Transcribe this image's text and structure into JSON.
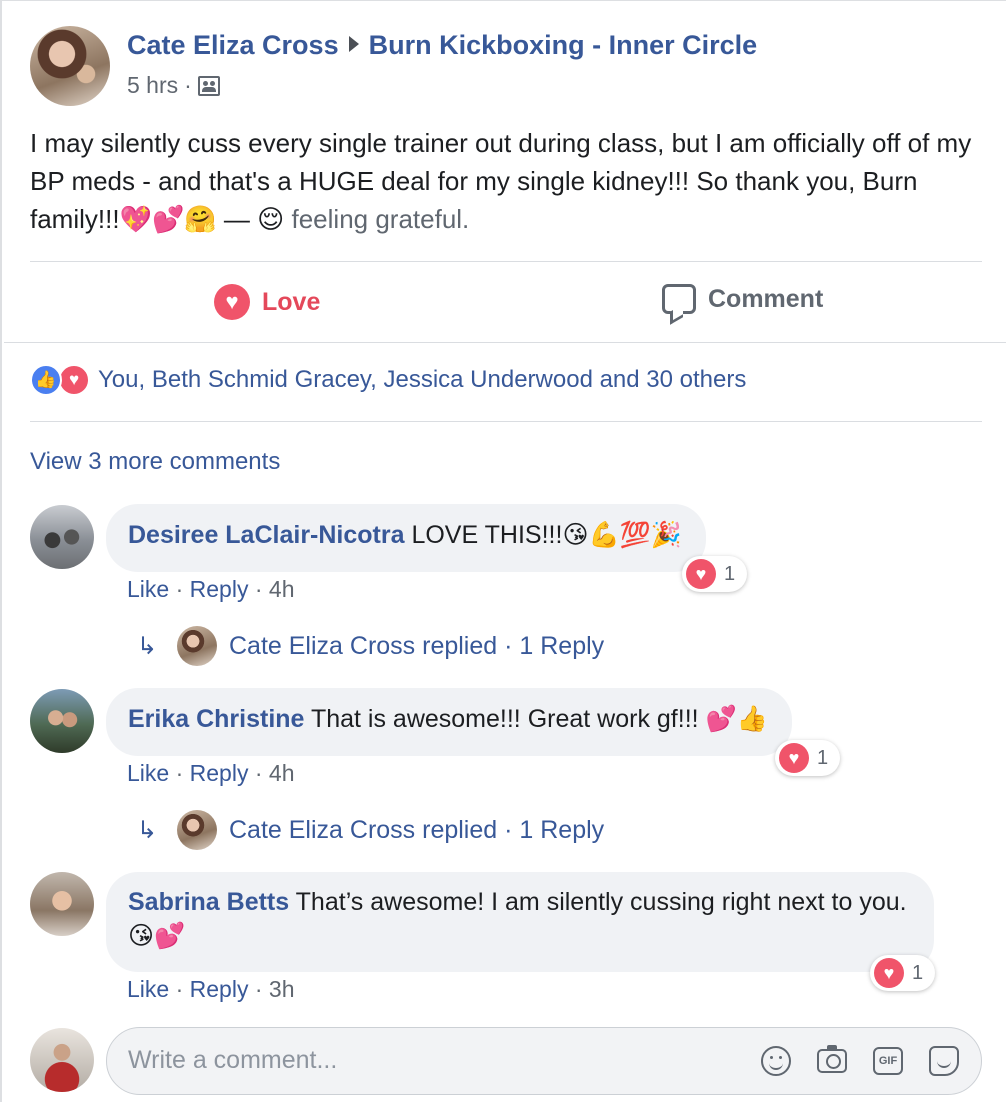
{
  "post": {
    "author": "Cate Eliza Cross",
    "group": "Burn Kickboxing - Inner Circle",
    "time": "5 hrs",
    "meta_sep": "·",
    "audience_icon": "group-audience-icon",
    "text": "I may silently cuss every single trainer out during class, but I am officially off of my BP meds - and that's a HUGE deal for my single kidney!!! So thank you, Burn family!!!",
    "emojis": "💖💕🤗",
    "dash": " — ",
    "feeling_emoji": "😌",
    "feeling": "feeling grateful."
  },
  "actions": {
    "love_label": "Love",
    "comment_label": "Comment"
  },
  "reactions": {
    "summary": "You, Beth Schmid Gracey, Jessica Underwood and 30 others",
    "like_icon": "👍",
    "love_icon": "♥"
  },
  "view_more": "View 3 more comments",
  "comments": [
    {
      "author": "Desiree LaClair-Nicotra",
      "text": " LOVE THIS!!!",
      "emojis": "😘💪💯🎉",
      "reaction_count": "1",
      "like": "Like",
      "reply": "Reply",
      "sep": "·",
      "time": "4h",
      "reply_arrow": "↳",
      "reply_summary": "Cate Eliza Cross replied · 1 Reply"
    },
    {
      "author": "Erika Christine",
      "text": " That is awesome!!! Great work gf!!! ",
      "emojis": "💕👍",
      "reaction_count": "1",
      "like": "Like",
      "reply": "Reply",
      "sep": "·",
      "time": "4h",
      "reply_arrow": "↳",
      "reply_summary": "Cate Eliza Cross replied · 1 Reply"
    },
    {
      "author": "Sabrina Betts",
      "text": " That’s awesome! I am silently cussing right next to you. ",
      "emojis": "😘💕",
      "reaction_count": "1",
      "like": "Like",
      "reply": "Reply",
      "sep": "·",
      "time": "3h"
    }
  ],
  "composer": {
    "placeholder": "Write a comment...",
    "gif_label": "GIF"
  }
}
